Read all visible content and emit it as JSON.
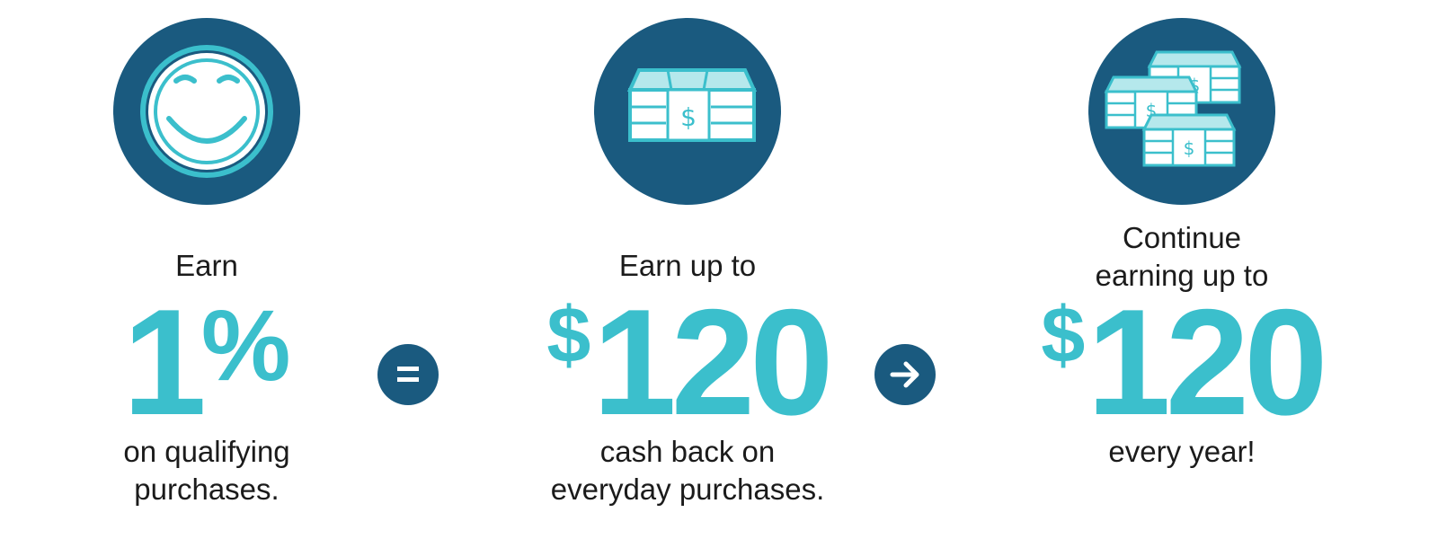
{
  "colors": {
    "dark_circle": "#1a5a7f",
    "accent": "#3bbfcc",
    "text": "#1b1b1b",
    "background": "#ffffff"
  },
  "columns": [
    {
      "icon": "smiley-face-icon",
      "heading": "Earn",
      "big_value": "1",
      "big_suffix": "%",
      "sub_line_1": "on qualifying",
      "sub_line_2": "purchases."
    },
    {
      "icon": "money-stack-icon",
      "heading": "Earn up to",
      "big_prefix": "$",
      "big_value": "120",
      "sub_line_1": "cash back on",
      "sub_line_2": "everyday purchases."
    },
    {
      "icon": "money-stacks-icon",
      "heading_line_1": "Continue",
      "heading_line_2": "earning up to",
      "big_prefix": "$",
      "big_value": "120",
      "sub_line_1": "every year!"
    }
  ],
  "operators": [
    {
      "icon": "equals-icon"
    },
    {
      "icon": "arrow-right-icon"
    }
  ]
}
